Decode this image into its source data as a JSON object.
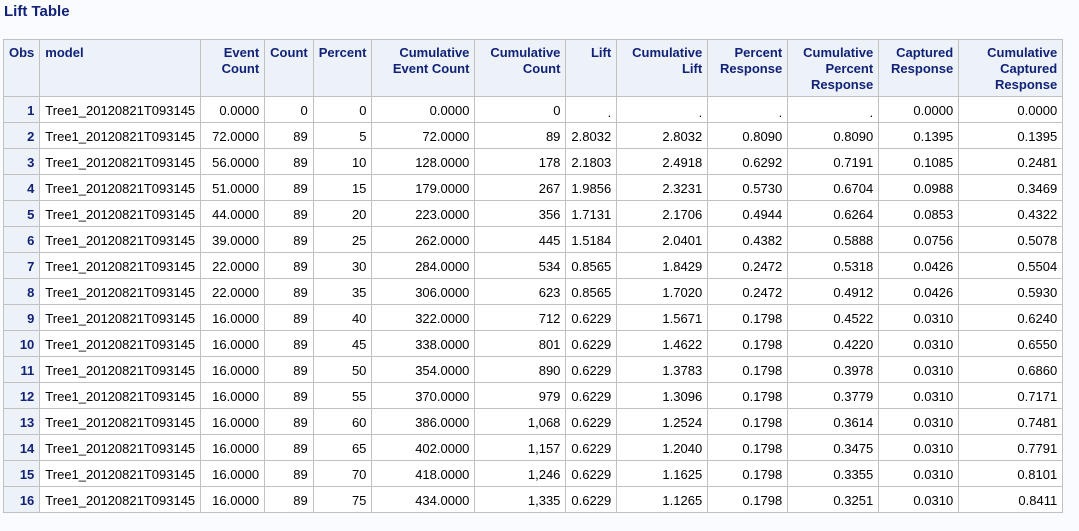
{
  "title": "Lift Table",
  "columns": [
    {
      "key": "obs",
      "label": "Obs"
    },
    {
      "key": "model",
      "label": "model"
    },
    {
      "key": "event_count",
      "label": "Event Count"
    },
    {
      "key": "count",
      "label": "Count"
    },
    {
      "key": "percent",
      "label": "Percent"
    },
    {
      "key": "cum_event_count",
      "label": "Cumulative Event Count"
    },
    {
      "key": "cum_count",
      "label": "Cumulative Count"
    },
    {
      "key": "lift",
      "label": "Lift"
    },
    {
      "key": "cum_lift",
      "label": "Cumulative Lift"
    },
    {
      "key": "pct_response",
      "label": "Percent Response"
    },
    {
      "key": "cum_pct_response",
      "label": "Cumulative Percent Response"
    },
    {
      "key": "captured_response",
      "label": "Captured Response"
    },
    {
      "key": "cum_captured_response",
      "label": "Cumulative Captured Response"
    }
  ],
  "rows": [
    [
      "1",
      "Tree1_20120821T093145",
      "0.0000",
      "0",
      "0",
      "0.0000",
      "0",
      ".",
      ".",
      ".",
      ".",
      "0.0000",
      "0.0000"
    ],
    [
      "2",
      "Tree1_20120821T093145",
      "72.0000",
      "89",
      "5",
      "72.0000",
      "89",
      "2.8032",
      "2.8032",
      "0.8090",
      "0.8090",
      "0.1395",
      "0.1395"
    ],
    [
      "3",
      "Tree1_20120821T093145",
      "56.0000",
      "89",
      "10",
      "128.0000",
      "178",
      "2.1803",
      "2.4918",
      "0.6292",
      "0.7191",
      "0.1085",
      "0.2481"
    ],
    [
      "4",
      "Tree1_20120821T093145",
      "51.0000",
      "89",
      "15",
      "179.0000",
      "267",
      "1.9856",
      "2.3231",
      "0.5730",
      "0.6704",
      "0.0988",
      "0.3469"
    ],
    [
      "5",
      "Tree1_20120821T093145",
      "44.0000",
      "89",
      "20",
      "223.0000",
      "356",
      "1.7131",
      "2.1706",
      "0.4944",
      "0.6264",
      "0.0853",
      "0.4322"
    ],
    [
      "6",
      "Tree1_20120821T093145",
      "39.0000",
      "89",
      "25",
      "262.0000",
      "445",
      "1.5184",
      "2.0401",
      "0.4382",
      "0.5888",
      "0.0756",
      "0.5078"
    ],
    [
      "7",
      "Tree1_20120821T093145",
      "22.0000",
      "89",
      "30",
      "284.0000",
      "534",
      "0.8565",
      "1.8429",
      "0.2472",
      "0.5318",
      "0.0426",
      "0.5504"
    ],
    [
      "8",
      "Tree1_20120821T093145",
      "22.0000",
      "89",
      "35",
      "306.0000",
      "623",
      "0.8565",
      "1.7020",
      "0.2472",
      "0.4912",
      "0.0426",
      "0.5930"
    ],
    [
      "9",
      "Tree1_20120821T093145",
      "16.0000",
      "89",
      "40",
      "322.0000",
      "712",
      "0.6229",
      "1.5671",
      "0.1798",
      "0.4522",
      "0.0310",
      "0.6240"
    ],
    [
      "10",
      "Tree1_20120821T093145",
      "16.0000",
      "89",
      "45",
      "338.0000",
      "801",
      "0.6229",
      "1.4622",
      "0.1798",
      "0.4220",
      "0.0310",
      "0.6550"
    ],
    [
      "11",
      "Tree1_20120821T093145",
      "16.0000",
      "89",
      "50",
      "354.0000",
      "890",
      "0.6229",
      "1.3783",
      "0.1798",
      "0.3978",
      "0.0310",
      "0.6860"
    ],
    [
      "12",
      "Tree1_20120821T093145",
      "16.0000",
      "89",
      "55",
      "370.0000",
      "979",
      "0.6229",
      "1.3096",
      "0.1798",
      "0.3779",
      "0.0310",
      "0.7171"
    ],
    [
      "13",
      "Tree1_20120821T093145",
      "16.0000",
      "89",
      "60",
      "386.0000",
      "1,068",
      "0.6229",
      "1.2524",
      "0.1798",
      "0.3614",
      "0.0310",
      "0.7481"
    ],
    [
      "14",
      "Tree1_20120821T093145",
      "16.0000",
      "89",
      "65",
      "402.0000",
      "1,157",
      "0.6229",
      "1.2040",
      "0.1798",
      "0.3475",
      "0.0310",
      "0.7791"
    ],
    [
      "15",
      "Tree1_20120821T093145",
      "16.0000",
      "89",
      "70",
      "418.0000",
      "1,246",
      "0.6229",
      "1.1625",
      "0.1798",
      "0.3355",
      "0.0310",
      "0.8101"
    ],
    [
      "16",
      "Tree1_20120821T093145",
      "16.0000",
      "89",
      "75",
      "434.0000",
      "1,335",
      "0.6229",
      "1.1265",
      "0.1798",
      "0.3251",
      "0.0310",
      "0.8411"
    ]
  ]
}
